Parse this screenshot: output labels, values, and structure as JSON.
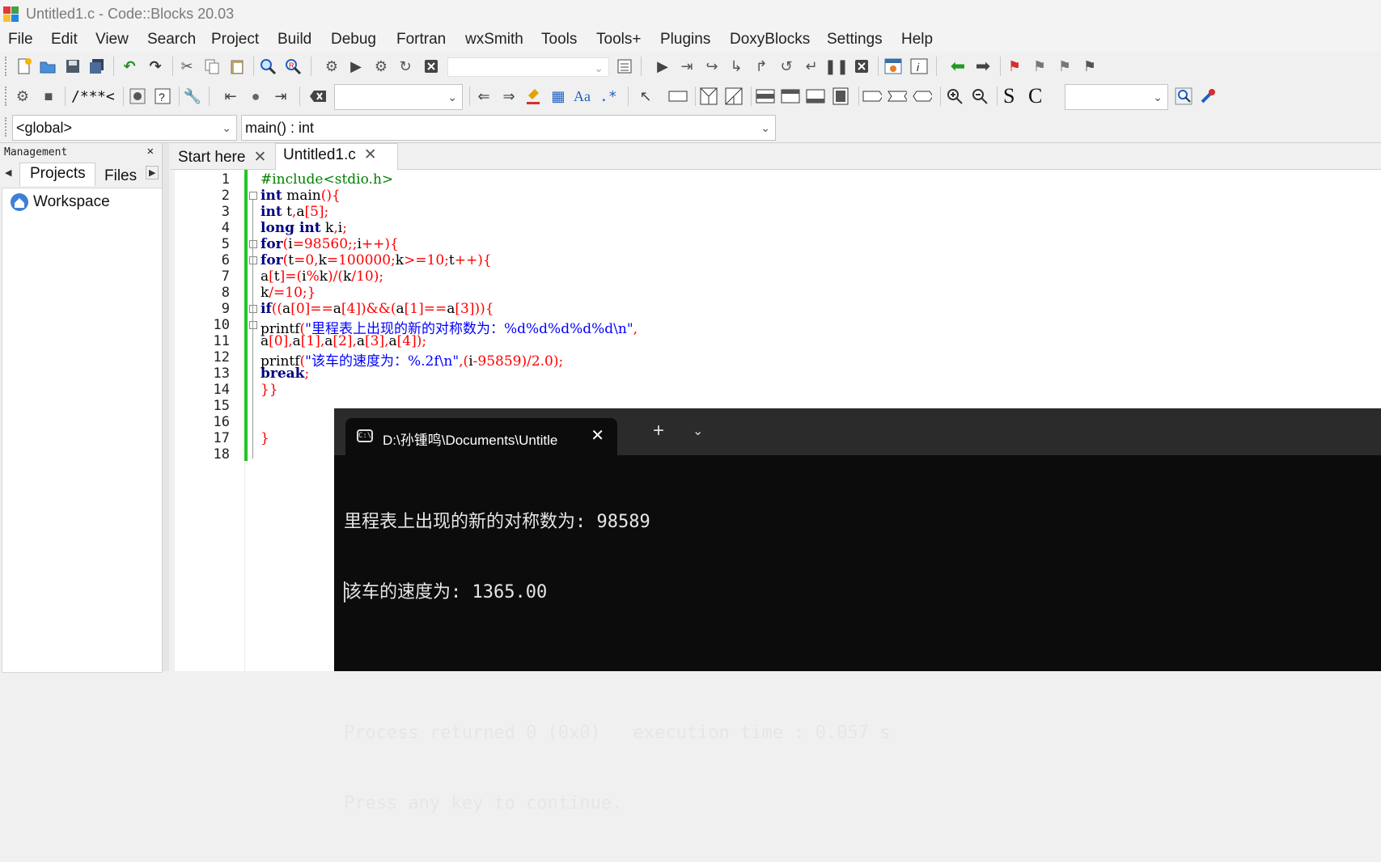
{
  "window": {
    "title": "Untitled1.c - Code::Blocks 20.03"
  },
  "menu": [
    "File",
    "Edit",
    "View",
    "Search",
    "Project",
    "Build",
    "Debug",
    "Fortran",
    "wxSmith",
    "Tools",
    "Tools+",
    "Plugins",
    "DoxyBlocks",
    "Settings",
    "Help"
  ],
  "toolbar": {
    "comment_doxy": "/**",
    "comment_line": "*<",
    "format_s": "S",
    "format_c": "C",
    "regex_label": ".*",
    "font_label": "Aa"
  },
  "codecompletion": {
    "scope": "<global>",
    "function": "main() : int"
  },
  "management": {
    "title": "Management",
    "tabs": [
      "Projects",
      "Files"
    ],
    "tree_root": "Workspace"
  },
  "editor": {
    "tabs": [
      "Start here",
      "Untitled1.c"
    ],
    "line_numbers": [
      "1",
      "2",
      "3",
      "4",
      "5",
      "6",
      "7",
      "8",
      "9",
      "10",
      "11",
      "12",
      "13",
      "14",
      "15",
      "16",
      "17",
      "18"
    ]
  },
  "terminal": {
    "tab_title": "D:\\孙锺鸣\\Documents\\Untitle",
    "output_line1": "里程表上出现的新的对称数为: 98589",
    "output_line2": "该车的速度为: 1365.00",
    "output_line3": "",
    "output_line4": "Process returned 0 (0x0)   execution time : 0.057 s",
    "output_line5": "Press any key to continue."
  },
  "colors": {
    "keyword": "#000080",
    "operator": "#ff0000",
    "string": "#0000ff",
    "preprocessor": "#008000",
    "changebar": "#24c324",
    "terminal_bg": "#0c0c0c"
  }
}
